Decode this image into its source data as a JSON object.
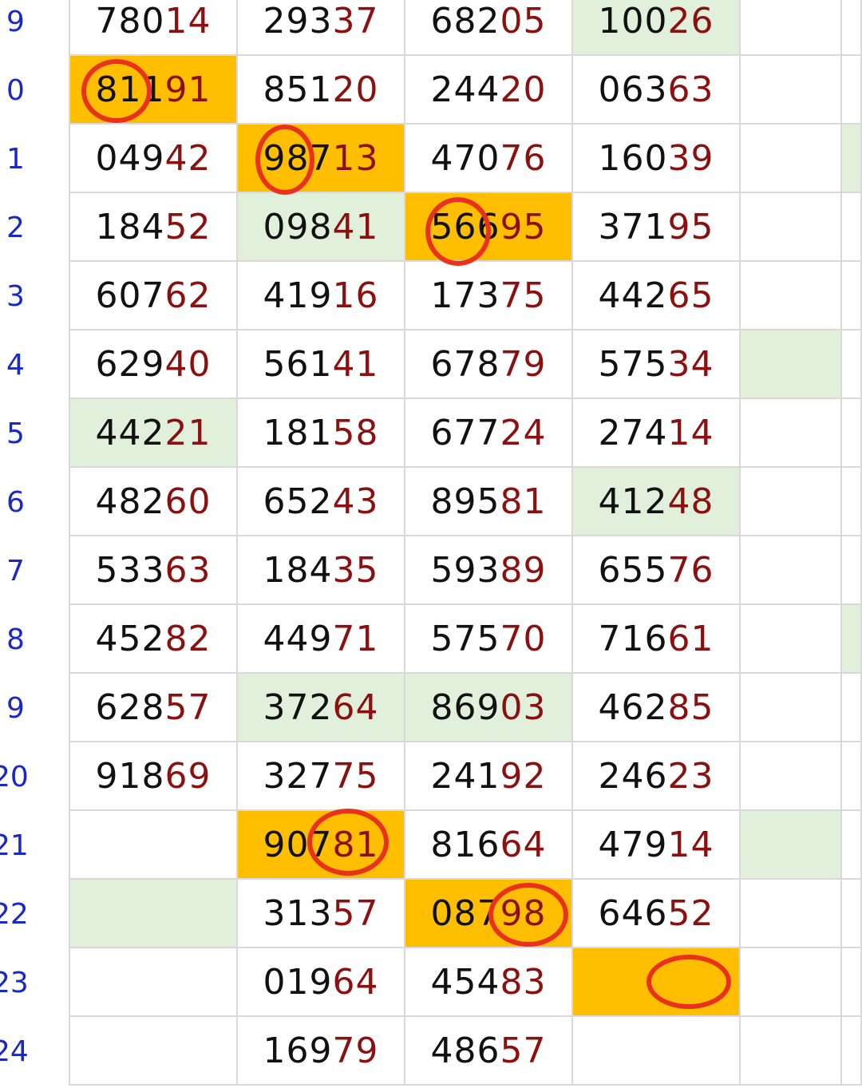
{
  "row_labels": [
    "9",
    "0",
    "1",
    "2",
    "3",
    "4",
    "5",
    "6",
    "7",
    "8",
    "9",
    "20",
    "21",
    "22",
    "23",
    "24"
  ],
  "rows": [
    [
      "78014",
      "29337",
      "68205",
      "10026",
      "",
      ""
    ],
    [
      "81191",
      "85120",
      "24420",
      "06363",
      "",
      ""
    ],
    [
      "04942",
      "98713",
      "47076",
      "16039",
      "",
      ""
    ],
    [
      "18452",
      "09841",
      "56695",
      "37195",
      "",
      ""
    ],
    [
      "60762",
      "41916",
      "17375",
      "44265",
      "",
      ""
    ],
    [
      "62940",
      "56141",
      "67879",
      "57534",
      "",
      ""
    ],
    [
      "44221",
      "18158",
      "67724",
      "27414",
      "",
      ""
    ],
    [
      "48260",
      "65243",
      "89581",
      "41248",
      "",
      ""
    ],
    [
      "53363",
      "18435",
      "59389",
      "65576",
      "",
      ""
    ],
    [
      "45282",
      "44971",
      "57570",
      "71661",
      "",
      ""
    ],
    [
      "62857",
      "37264",
      "86903",
      "46285",
      "",
      ""
    ],
    [
      "91869",
      "32775",
      "24192",
      "24623",
      "",
      ""
    ],
    [
      "",
      "90781",
      "81664",
      "47914",
      "",
      ""
    ],
    [
      "",
      "31357",
      "08798",
      "64652",
      "",
      ""
    ],
    [
      "",
      "01964",
      "45483",
      "",
      "",
      ""
    ],
    [
      "",
      "16979",
      "48657",
      "",
      "",
      ""
    ]
  ],
  "highlights": {
    "orange": [
      [
        1,
        0
      ],
      [
        2,
        1
      ],
      [
        3,
        2
      ],
      [
        12,
        1
      ],
      [
        13,
        2
      ],
      [
        14,
        3
      ]
    ],
    "green": [
      [
        0,
        3
      ],
      [
        3,
        1
      ],
      [
        5,
        4
      ],
      [
        6,
        0
      ],
      [
        7,
        3
      ],
      [
        10,
        1
      ],
      [
        10,
        2
      ],
      [
        12,
        4
      ],
      [
        13,
        0
      ],
      [
        2,
        5
      ],
      [
        9,
        5
      ]
    ]
  },
  "colors": {
    "row_label": "#1a27c9",
    "digit_black": "#111111",
    "digit_red": "#8b1010",
    "highlight_orange": "#ffbf00",
    "highlight_green": "#e1f0da",
    "circle": "#e8321e",
    "grid_line": "#d9d9d9"
  }
}
